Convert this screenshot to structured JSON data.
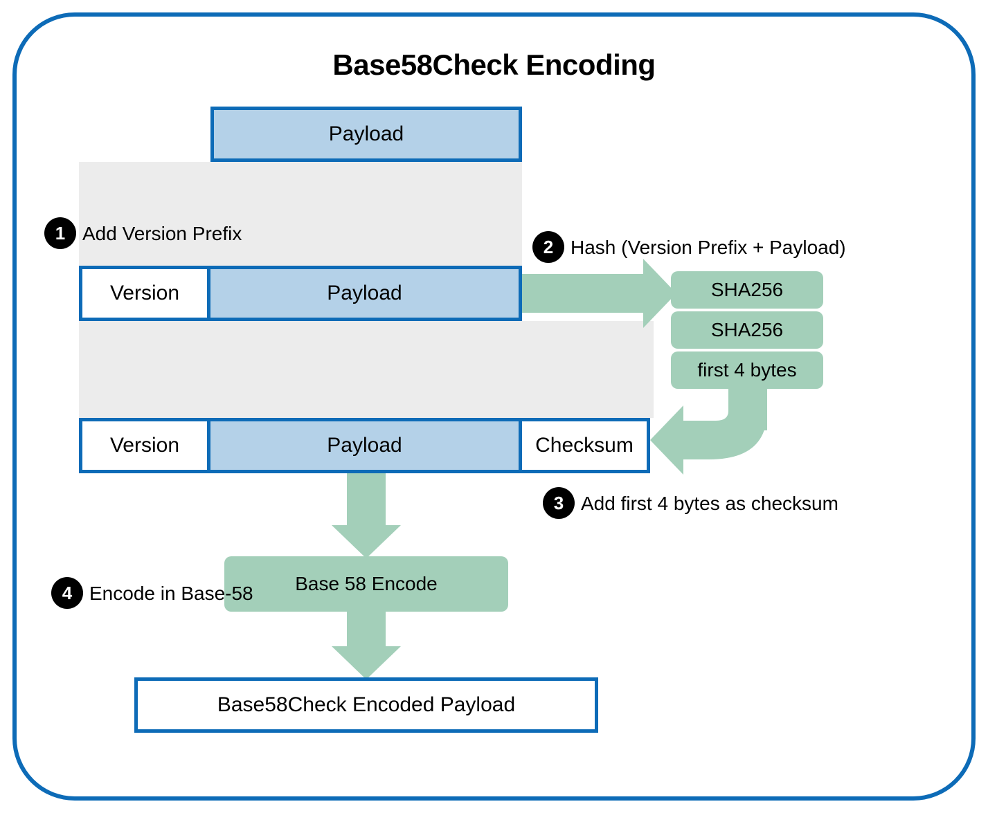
{
  "title": "Base58Check Encoding",
  "row0": {
    "payload": "Payload"
  },
  "step1": {
    "num": "1",
    "label": "Add Version Prefix"
  },
  "row1": {
    "version": "Version",
    "payload": "Payload"
  },
  "step2": {
    "num": "2",
    "label": "Hash (Version Prefix + Payload)"
  },
  "hash": {
    "a": "SHA256",
    "b": "SHA256",
    "c": "first 4 bytes"
  },
  "row2": {
    "version": "Version",
    "payload": "Payload",
    "checksum": "Checksum"
  },
  "step3": {
    "num": "3",
    "label": "Add first 4 bytes as checksum"
  },
  "encode": {
    "label": "Base 58 Encode"
  },
  "step4": {
    "num": "4",
    "label": "Encode in Base-58"
  },
  "result": {
    "label": "Base58Check Encoded Payload"
  },
  "chart_data": {
    "type": "flow",
    "title": "Base58Check Encoding",
    "steps": [
      {
        "n": 1,
        "label": "Add Version Prefix",
        "input": [
          "Payload"
        ],
        "output": [
          "Version",
          "Payload"
        ]
      },
      {
        "n": 2,
        "label": "Hash (Version Prefix + Payload)",
        "ops": [
          "SHA256",
          "SHA256",
          "first 4 bytes"
        ]
      },
      {
        "n": 3,
        "label": "Add first 4 bytes as checksum",
        "output": [
          "Version",
          "Payload",
          "Checksum"
        ]
      },
      {
        "n": 4,
        "label": "Encode in Base-58",
        "op": "Base 58 Encode",
        "output": "Base58Check Encoded Payload"
      }
    ]
  }
}
